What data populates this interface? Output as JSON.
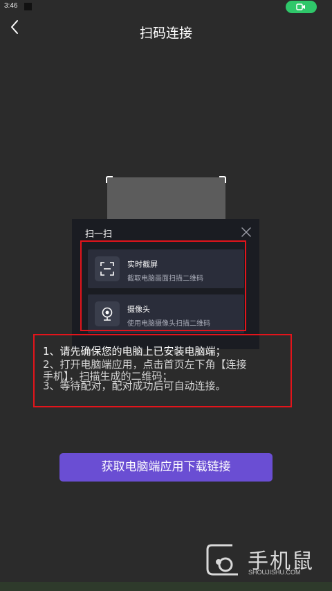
{
  "status_bar": {
    "time": "3:46"
  },
  "header": {
    "title": "扫码连接",
    "back_icon": "chevron-left-icon"
  },
  "dialog": {
    "title": "扫一扫",
    "close_icon": "close-icon",
    "options": [
      {
        "name": "实时截屏",
        "desc": "截取电脑画面扫描二维码",
        "icon": "screenshot-frame-icon"
      },
      {
        "name": "摄像头",
        "desc": "使用电脑摄像头扫描二维码",
        "icon": "webcam-icon"
      }
    ]
  },
  "instructions": {
    "line1": "1、请先确保您的电脑上已安装电脑端；",
    "line2": "2、打开电脑端应用，点击首页左下角【连接",
    "line3": "手机】，扫描生成的二维码；",
    "line4": "3、等待配对，配对成功后可自动连接。"
  },
  "download_button": {
    "label": "获取电脑端应用下载链接"
  },
  "watermark": {
    "text": "手机鼠",
    "site": "SHOUJISHU.COM"
  },
  "colors": {
    "background": "#2b2b2b",
    "dialog": "#1a1c22",
    "option": "#2a2d3a",
    "accent_button": "#6a4ed3",
    "highlight_box": "#e3141b",
    "camera_pill": "#2fc76a"
  }
}
